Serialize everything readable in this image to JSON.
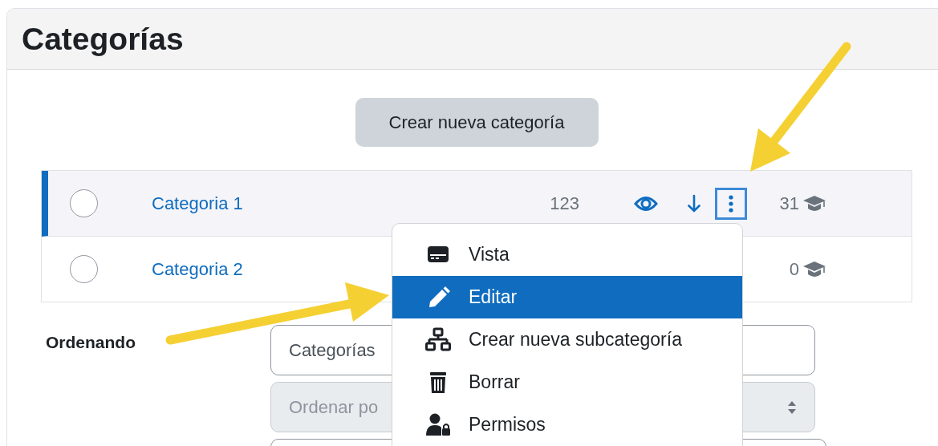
{
  "panel": {
    "title": "Categorías"
  },
  "create_button": {
    "label": "Crear nueva categoría"
  },
  "categories": [
    {
      "name": "Categoria 1",
      "selected": true,
      "checked": false,
      "count": "123",
      "actions": [
        {
          "kind": "visibility"
        },
        {
          "kind": "move-down"
        },
        {
          "kind": "menu",
          "highlighted": true
        }
      ],
      "courses": "31"
    },
    {
      "name": "Categoria 2",
      "selected": false,
      "checked": false,
      "courses": "0"
    }
  ],
  "sort_form": {
    "label": "Ordenando",
    "fields": [
      {
        "value": "Categorías",
        "disabled": false
      },
      {
        "value": "Ordenar po",
        "disabled": true,
        "has_caret": true
      },
      {
        "disabled": false
      }
    ]
  },
  "action_menu": {
    "items": [
      {
        "kind": "view",
        "label": "Vista",
        "selected": false
      },
      {
        "kind": "edit",
        "label": "Editar",
        "selected": true
      },
      {
        "kind": "subcategory",
        "label": "Crear nueva subcategoría",
        "selected": false
      },
      {
        "kind": "delete",
        "label": "Borrar",
        "selected": false
      },
      {
        "kind": "permissions",
        "label": "Permisos",
        "selected": false
      }
    ]
  }
}
